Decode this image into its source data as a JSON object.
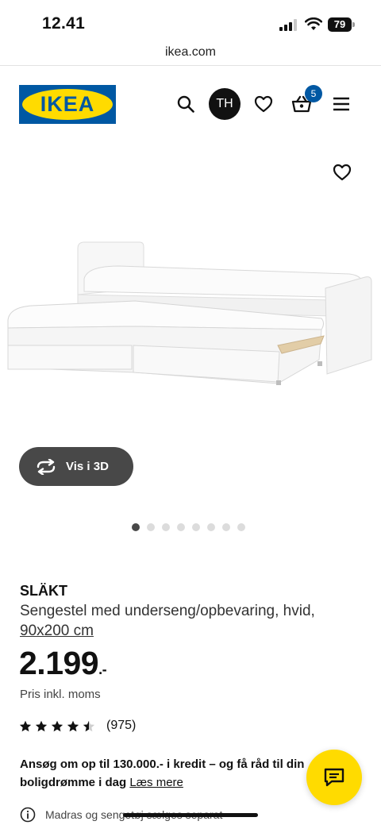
{
  "status_bar": {
    "time": "12.41",
    "battery": "79"
  },
  "browser": {
    "url": "ikea.com"
  },
  "header": {
    "logo_text": "IKEA",
    "avatar_initials": "TH",
    "cart_count": "5",
    "icons": [
      "search-icon",
      "heart-icon",
      "cart-icon",
      "menu-icon"
    ]
  },
  "gallery": {
    "view_3d_label": "Vis i 3D",
    "image_count": 8,
    "active_index": 0
  },
  "product": {
    "name": "SLÄKT",
    "description": "Sengestel med underseng/opbevaring, hvid,",
    "size": "90x200 cm",
    "price": "2.199",
    "price_suffix": ".-",
    "price_note": "Pris inkl. moms",
    "rating": 4.5,
    "rating_count": "(975)"
  },
  "promo": {
    "text": "Ansøg om op til 130.000.- i kredit – og få råd til din boligdrømme i dag",
    "link": "Læs mere"
  },
  "info_note": "Madras og sengetøj sælges separat",
  "colors": {
    "ikea_blue": "#0058a3",
    "ikea_yellow": "#ffdb00",
    "badge_blue": "#0058a3"
  }
}
